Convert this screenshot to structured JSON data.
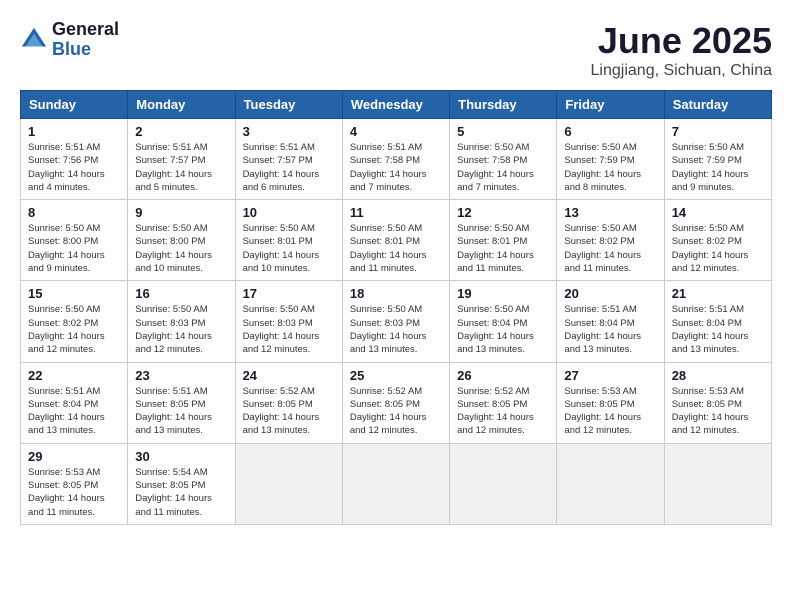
{
  "header": {
    "logo_general": "General",
    "logo_blue": "Blue",
    "month_title": "June 2025",
    "location": "Lingjiang, Sichuan, China"
  },
  "weekdays": [
    "Sunday",
    "Monday",
    "Tuesday",
    "Wednesday",
    "Thursday",
    "Friday",
    "Saturday"
  ],
  "weeks": [
    [
      {
        "day": "1",
        "sunrise": "5:51 AM",
        "sunset": "7:56 PM",
        "daylight": "14 hours and 4 minutes."
      },
      {
        "day": "2",
        "sunrise": "5:51 AM",
        "sunset": "7:57 PM",
        "daylight": "14 hours and 5 minutes."
      },
      {
        "day": "3",
        "sunrise": "5:51 AM",
        "sunset": "7:57 PM",
        "daylight": "14 hours and 6 minutes."
      },
      {
        "day": "4",
        "sunrise": "5:51 AM",
        "sunset": "7:58 PM",
        "daylight": "14 hours and 7 minutes."
      },
      {
        "day": "5",
        "sunrise": "5:50 AM",
        "sunset": "7:58 PM",
        "daylight": "14 hours and 7 minutes."
      },
      {
        "day": "6",
        "sunrise": "5:50 AM",
        "sunset": "7:59 PM",
        "daylight": "14 hours and 8 minutes."
      },
      {
        "day": "7",
        "sunrise": "5:50 AM",
        "sunset": "7:59 PM",
        "daylight": "14 hours and 9 minutes."
      }
    ],
    [
      {
        "day": "8",
        "sunrise": "5:50 AM",
        "sunset": "8:00 PM",
        "daylight": "14 hours and 9 minutes."
      },
      {
        "day": "9",
        "sunrise": "5:50 AM",
        "sunset": "8:00 PM",
        "daylight": "14 hours and 10 minutes."
      },
      {
        "day": "10",
        "sunrise": "5:50 AM",
        "sunset": "8:01 PM",
        "daylight": "14 hours and 10 minutes."
      },
      {
        "day": "11",
        "sunrise": "5:50 AM",
        "sunset": "8:01 PM",
        "daylight": "14 hours and 11 minutes."
      },
      {
        "day": "12",
        "sunrise": "5:50 AM",
        "sunset": "8:01 PM",
        "daylight": "14 hours and 11 minutes."
      },
      {
        "day": "13",
        "sunrise": "5:50 AM",
        "sunset": "8:02 PM",
        "daylight": "14 hours and 11 minutes."
      },
      {
        "day": "14",
        "sunrise": "5:50 AM",
        "sunset": "8:02 PM",
        "daylight": "14 hours and 12 minutes."
      }
    ],
    [
      {
        "day": "15",
        "sunrise": "5:50 AM",
        "sunset": "8:02 PM",
        "daylight": "14 hours and 12 minutes."
      },
      {
        "day": "16",
        "sunrise": "5:50 AM",
        "sunset": "8:03 PM",
        "daylight": "14 hours and 12 minutes."
      },
      {
        "day": "17",
        "sunrise": "5:50 AM",
        "sunset": "8:03 PM",
        "daylight": "14 hours and 12 minutes."
      },
      {
        "day": "18",
        "sunrise": "5:50 AM",
        "sunset": "8:03 PM",
        "daylight": "14 hours and 13 minutes."
      },
      {
        "day": "19",
        "sunrise": "5:50 AM",
        "sunset": "8:04 PM",
        "daylight": "14 hours and 13 minutes."
      },
      {
        "day": "20",
        "sunrise": "5:51 AM",
        "sunset": "8:04 PM",
        "daylight": "14 hours and 13 minutes."
      },
      {
        "day": "21",
        "sunrise": "5:51 AM",
        "sunset": "8:04 PM",
        "daylight": "14 hours and 13 minutes."
      }
    ],
    [
      {
        "day": "22",
        "sunrise": "5:51 AM",
        "sunset": "8:04 PM",
        "daylight": "14 hours and 13 minutes."
      },
      {
        "day": "23",
        "sunrise": "5:51 AM",
        "sunset": "8:05 PM",
        "daylight": "14 hours and 13 minutes."
      },
      {
        "day": "24",
        "sunrise": "5:52 AM",
        "sunset": "8:05 PM",
        "daylight": "14 hours and 13 minutes."
      },
      {
        "day": "25",
        "sunrise": "5:52 AM",
        "sunset": "8:05 PM",
        "daylight": "14 hours and 12 minutes."
      },
      {
        "day": "26",
        "sunrise": "5:52 AM",
        "sunset": "8:05 PM",
        "daylight": "14 hours and 12 minutes."
      },
      {
        "day": "27",
        "sunrise": "5:53 AM",
        "sunset": "8:05 PM",
        "daylight": "14 hours and 12 minutes."
      },
      {
        "day": "28",
        "sunrise": "5:53 AM",
        "sunset": "8:05 PM",
        "daylight": "14 hours and 12 minutes."
      }
    ],
    [
      {
        "day": "29",
        "sunrise": "5:53 AM",
        "sunset": "8:05 PM",
        "daylight": "14 hours and 11 minutes."
      },
      {
        "day": "30",
        "sunrise": "5:54 AM",
        "sunset": "8:05 PM",
        "daylight": "14 hours and 11 minutes."
      },
      null,
      null,
      null,
      null,
      null
    ]
  ]
}
